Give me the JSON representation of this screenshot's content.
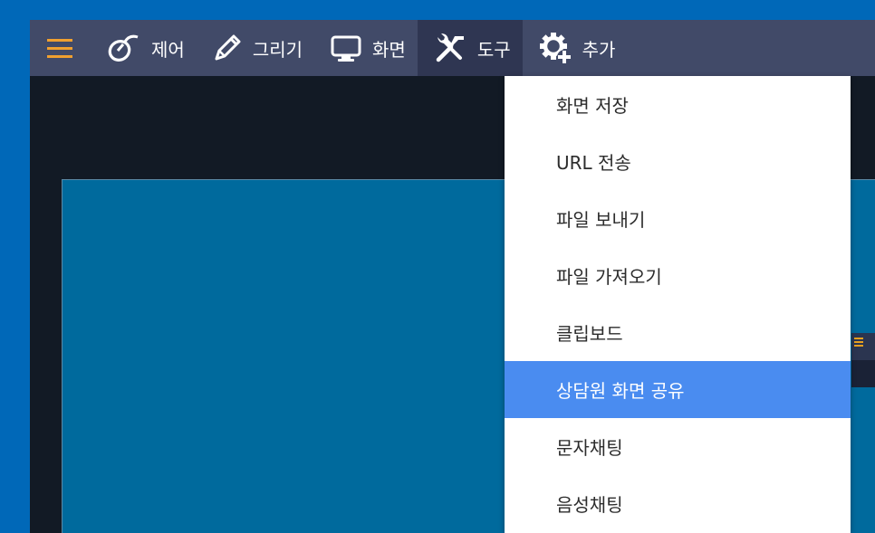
{
  "toolbar": {
    "menu_icon": "hamburger-icon",
    "items": [
      {
        "label": "제어",
        "icon": "mouse-icon",
        "active": false
      },
      {
        "label": "그리기",
        "icon": "pencil-icon",
        "active": false
      },
      {
        "label": "화면",
        "icon": "monitor-icon",
        "active": false
      },
      {
        "label": "도구",
        "icon": "tools-icon",
        "active": true
      },
      {
        "label": "추가",
        "icon": "gear-plus-icon",
        "active": false
      }
    ]
  },
  "tools_menu": {
    "items": [
      {
        "label": "화면 저장",
        "selected": false
      },
      {
        "label": "URL 전송",
        "selected": false
      },
      {
        "label": "파일 보내기",
        "selected": false
      },
      {
        "label": "파일 가져오기",
        "selected": false
      },
      {
        "label": "클립보드",
        "selected": false
      },
      {
        "label": "상담원 화면 공유",
        "selected": true
      },
      {
        "label": "문자채팅",
        "selected": false
      },
      {
        "label": "음성채팅",
        "selected": false
      }
    ]
  },
  "colors": {
    "background": "#0068b8",
    "toolbar": "#414a68",
    "toolbar_active": "#2f3652",
    "remote_screen": "#006a9d",
    "menu_highlight": "#4a8cf0",
    "hamburger": "#f0a030"
  }
}
